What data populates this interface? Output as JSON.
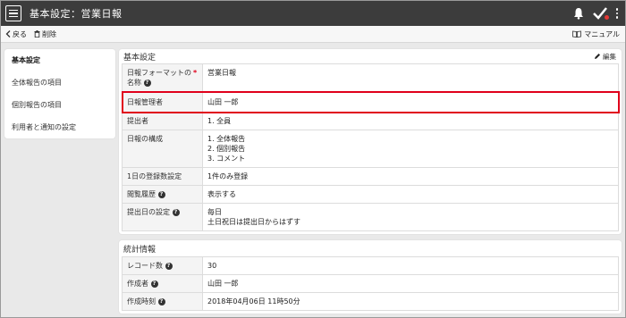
{
  "header": {
    "title": "基本設定：営業日報",
    "colors": {
      "bar": "#3c3c3c",
      "accent_red": "#e53935"
    }
  },
  "actions": {
    "back_label": "戻る",
    "delete_label": "削除",
    "manual_label": "マニュアル"
  },
  "sidebar": {
    "items": [
      {
        "label": "基本設定",
        "active": true
      },
      {
        "label": "全体報告の項目",
        "active": false
      },
      {
        "label": "個別報告の項目",
        "active": false
      },
      {
        "label": "利用者と通知の設定",
        "active": false
      }
    ]
  },
  "basic": {
    "title": "基本設定",
    "edit_label": "編集",
    "rows": {
      "format_name_label_1": "日報フォーマットの",
      "format_name_label_2": "名称",
      "format_name_value": "営業日報",
      "manager_label": "日報管理者",
      "manager_value": "山田 一郎",
      "submitter_label": "提出者",
      "submitter_value": "1. 全員",
      "composition_label": "日報の構成",
      "composition_values": [
        "1. 全体報告",
        "2. 個別報告",
        "3. コメント"
      ],
      "daily_count_label": "1日の登録数設定",
      "daily_count_value": "1件のみ登録",
      "view_history_label": "閲覧履歴",
      "view_history_value": "表示する",
      "submit_date_label": "提出日の設定",
      "submit_date_value_1": "毎日",
      "submit_date_value_2": "土日祝日は提出日からはずす"
    }
  },
  "stats": {
    "title": "統計情報",
    "record_count_label": "レコード数",
    "record_count_value": "30",
    "creator_label": "作成者",
    "creator_value": "山田 一郎",
    "created_at_label": "作成時刻",
    "created_at_value": "2018年04月06日 11時50分"
  }
}
